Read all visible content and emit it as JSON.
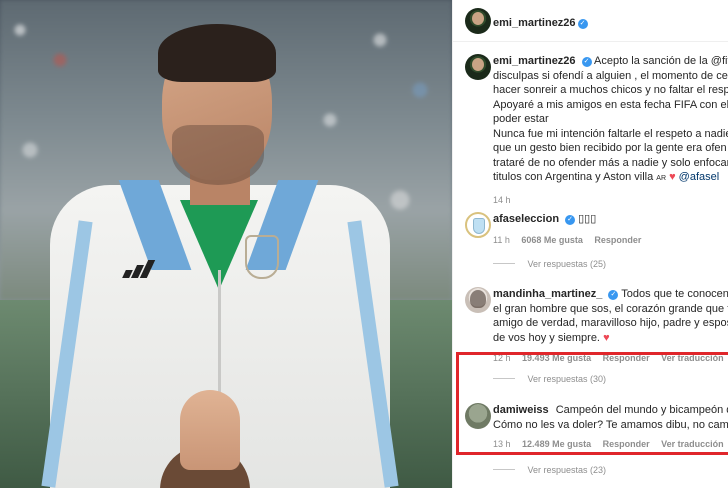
{
  "colors": {
    "highlight": "#e0262b",
    "heart": "#ed4956",
    "verified": "#3897f0",
    "meta": "#8e8e8e"
  },
  "post": {
    "author": "emi_martinez26"
  },
  "caption": {
    "author": "emi_martinez26",
    "lines": [
      "Acepto la sanción de la @fifa",
      "disculpas si ofendí a alguien , el momento de cel",
      "hacer sonreir a muchos chicos y no faltar el respe",
      "Apoyaré a mis amigos en esta fecha FIFA con el c",
      "poder estar",
      "Nunca fue mi intención faltarle el respeto a nadie",
      "que un gesto bien recibido por la gente era ofen",
      "trataré de no ofender más a nadie y solo enfocar",
      "titulos con Argentina y Aston villa"
    ],
    "flag": "AR",
    "end_mention": "@afasel",
    "time": "14 h"
  },
  "comments": [
    {
      "user": "afaseleccion",
      "text": "▯▯▯",
      "time": "11 h",
      "likes": "6068 Me gusta",
      "reply": "Responder",
      "replies": "Ver respuestas (25)"
    },
    {
      "user": "mandinha_martinez_",
      "lines": [
        "Todos que te conocen d",
        "el gran hombre que sos, el corazón grande que t",
        "amigo de verdad, maravilloso hijo, padre y espos",
        "de vos hoy y siempre."
      ],
      "time": "12 h",
      "likes": "19.493 Me gusta",
      "reply": "Responder",
      "translate": "Ver traducción",
      "replies": "Ver respuestas (30)"
    },
    {
      "user": "damiweiss",
      "lines": [
        "Campeón del mundo y bicampeón de",
        "Cómo no les va doler? Te amamos dibu, no camb"
      ],
      "time": "13 h",
      "likes": "12.489 Me gusta",
      "reply": "Responder",
      "translate": "Ver traducción",
      "replies": "Ver respuestas (23)"
    }
  ],
  "icons": {
    "verified": "verified-badge-icon",
    "heart": "heart-icon"
  }
}
